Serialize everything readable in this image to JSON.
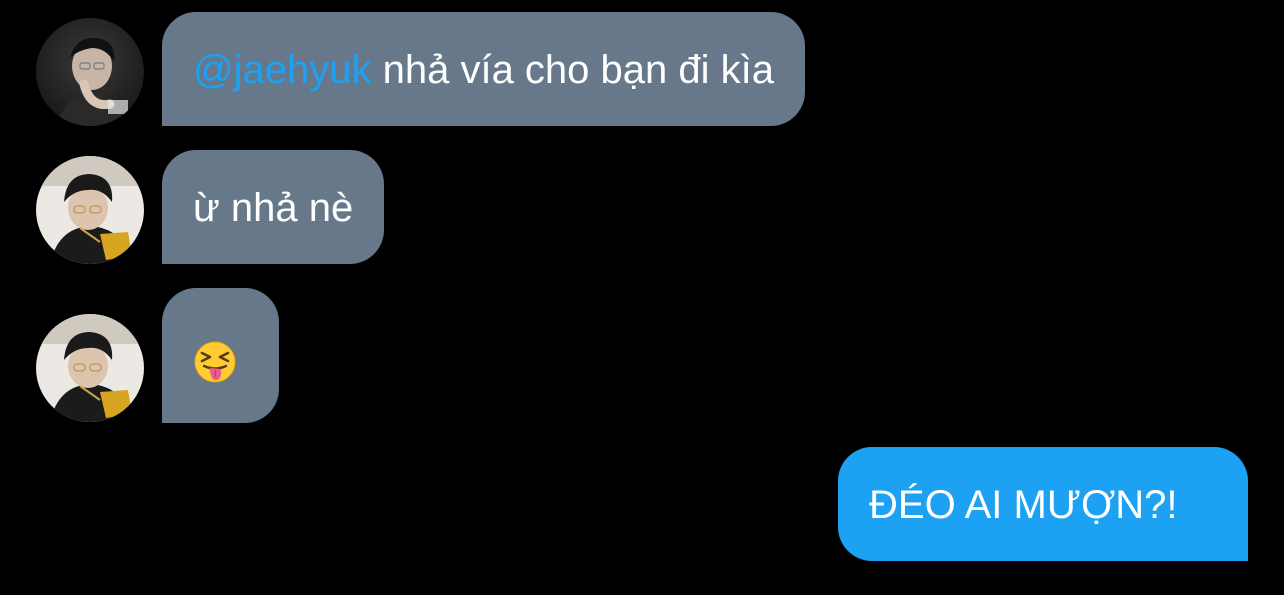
{
  "conversation": {
    "messages": [
      {
        "sender_avatar": "user-avatar-1",
        "mention": "@jaehyuk",
        "text": " nhả vía cho bạn đi kìa",
        "direction": "incoming"
      },
      {
        "sender_avatar": "user-avatar-2",
        "text": "ừ nhả nè",
        "direction": "incoming"
      },
      {
        "sender_avatar": "user-avatar-2",
        "emoji": "squinting-face-with-tongue-icon",
        "direction": "incoming"
      },
      {
        "text": "ĐÉO AI MƯỢN?!",
        "direction": "outgoing"
      }
    ]
  },
  "colors": {
    "background": "#000000",
    "incoming_bubble": "#66788a",
    "outgoing_bubble": "#1da1f2",
    "mention": "#1da1f2",
    "text": "#ffffff"
  }
}
